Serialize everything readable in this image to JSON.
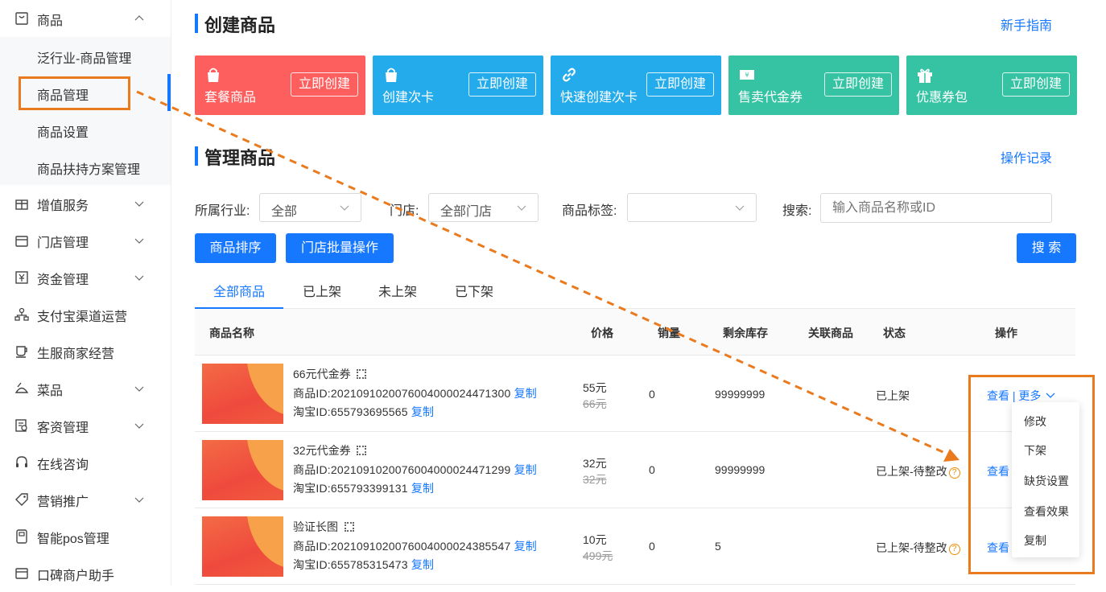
{
  "sidebar": {
    "items": [
      {
        "label": "商品",
        "icon": "bag-icon",
        "expanded": true
      },
      {
        "label": "增值服务",
        "icon": "gift-icon"
      },
      {
        "label": "门店管理",
        "icon": "store-icon"
      },
      {
        "label": "资金管理",
        "icon": "yen-icon"
      },
      {
        "label": "支付宝渠道运营",
        "icon": "network-icon"
      },
      {
        "label": "生服商家经营",
        "icon": "cup-icon"
      },
      {
        "label": "菜品",
        "icon": "dish-icon"
      },
      {
        "label": "客资管理",
        "icon": "contact-icon"
      },
      {
        "label": "在线咨询",
        "icon": "headset-icon"
      },
      {
        "label": "营销推广",
        "icon": "tag-icon"
      },
      {
        "label": "智能pos管理",
        "icon": "pos-icon"
      },
      {
        "label": "口碑商户助手",
        "icon": "assistant-icon"
      }
    ],
    "sub_items": [
      "泛行业-商品管理",
      "商品管理",
      "商品设置",
      "商品扶持方案管理"
    ]
  },
  "create": {
    "title": "创建商品",
    "guide_link": "新手指南",
    "cards": [
      {
        "title": "套餐商品",
        "button": "立即创建",
        "color": "#fd5e5e",
        "icon": "bag-icon"
      },
      {
        "title": "创建次卡",
        "button": "立即创建",
        "color": "#24abeb",
        "icon": "bag-icon"
      },
      {
        "title": "快速创建次卡",
        "button": "立即创建",
        "color": "#24abeb",
        "icon": "link-icon"
      },
      {
        "title": "售卖代金券",
        "button": "立即创建",
        "color": "#36c3a4",
        "icon": "voucher-icon"
      },
      {
        "title": "优惠券包",
        "button": "立即创建",
        "color": "#36c3a4",
        "icon": "gift-icon"
      }
    ]
  },
  "manage": {
    "title": "管理商品",
    "log_link": "操作记录",
    "filters": {
      "industry_label": "所属行业:",
      "industry_value": "全部",
      "store_label": "门店:",
      "store_value": "全部门店",
      "tag_label": "商品标签:",
      "tag_value": "",
      "search_label": "搜索:",
      "search_placeholder": "输入商品名称或ID"
    },
    "buttons": {
      "sort": "商品排序",
      "batch": "门店批量操作",
      "search": "搜 索"
    },
    "tabs": [
      "全部商品",
      "已上架",
      "未上架",
      "已下架"
    ],
    "active_tab": "全部商品",
    "columns": [
      "商品名称",
      "价格",
      "销量",
      "剩余库存",
      "关联商品",
      "状态",
      "操作"
    ],
    "rows": [
      {
        "name": "66元代金券",
        "product_id_label": "商品ID:",
        "product_id": "2021091020076004000024471300",
        "copy": "复制",
        "taobao_label": "淘宝ID:",
        "taobao_id": "655793695565",
        "price": "55元",
        "orig_price": "66元",
        "sales": "0",
        "stock": "99999999",
        "status": "已上架",
        "view": "查看",
        "more": "更多"
      },
      {
        "name": "32元代金券",
        "product_id_label": "商品ID:",
        "product_id": "2021091020076004000024471299",
        "copy": "复制",
        "taobao_label": "淘宝ID:",
        "taobao_id": "655793399131",
        "price": "32元",
        "orig_price": "32元",
        "sales": "0",
        "stock": "99999999",
        "status": "已上架-待整改",
        "view": "查看"
      },
      {
        "name": "验证长图",
        "product_id_label": "商品ID:",
        "product_id": "2021091020076004000024385547",
        "copy": "复制",
        "taobao_label": "淘宝ID:",
        "taobao_id": "655785315473",
        "price": "10元",
        "orig_price": "499元",
        "sales": "0",
        "stock": "5",
        "status": "已上架-待整改",
        "view": "查看"
      }
    ],
    "separator": "|",
    "more_menu": [
      "修改",
      "下架",
      "缺货设置",
      "查看效果",
      "复制"
    ]
  },
  "colors": {
    "accent": "#1677ff",
    "highlight": "#ea7a1e"
  }
}
